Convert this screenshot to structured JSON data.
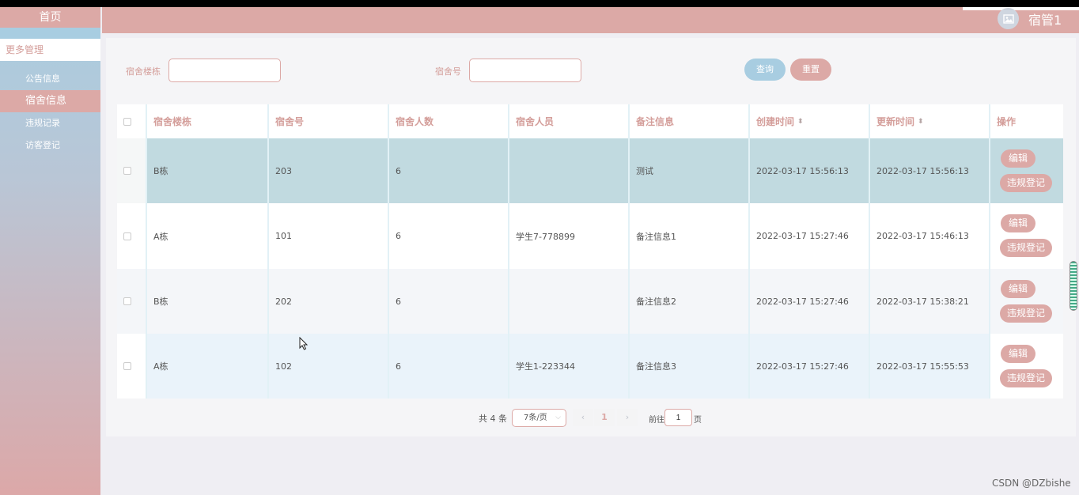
{
  "sidebar": {
    "home": "首页",
    "group": "更多管理",
    "items": [
      {
        "label": "公告信息",
        "active": false
      },
      {
        "label": "宿舍信息",
        "active": true
      },
      {
        "label": "违规记录",
        "active": false
      },
      {
        "label": "访客登记",
        "active": false
      }
    ]
  },
  "header": {
    "user_name": "宿管1"
  },
  "search": {
    "building_label": "宿舍楼栋",
    "building_value": "",
    "room_label": "宿舍号",
    "room_value": "",
    "query_button": "查询",
    "reset_button": "重置"
  },
  "table": {
    "columns": [
      "宿舍楼栋",
      "宿舍号",
      "宿舍人数",
      "宿舍人员",
      "备注信息",
      "创建时间",
      "更新时间",
      "操作"
    ],
    "rows": [
      {
        "building": "B栋",
        "room": "203",
        "count": "6",
        "members": "",
        "note": "测试",
        "created": "2022-03-17 15:56:13",
        "updated": "2022-03-17 15:56:13"
      },
      {
        "building": "A栋",
        "room": "101",
        "count": "6",
        "members": "学生7-778899",
        "note": "备注信息1",
        "created": "2022-03-17 15:27:46",
        "updated": "2022-03-17 15:46:13"
      },
      {
        "building": "B栋",
        "room": "202",
        "count": "6",
        "members": "",
        "note": "备注信息2",
        "created": "2022-03-17 15:27:46",
        "updated": "2022-03-17 15:38:21"
      },
      {
        "building": "A栋",
        "room": "102",
        "count": "6",
        "members": "学生1-223344",
        "note": "备注信息3",
        "created": "2022-03-17 15:27:46",
        "updated": "2022-03-17 15:55:53"
      }
    ],
    "edit_label": "编辑",
    "violation_label": "违规登记"
  },
  "pagination": {
    "total": "共 4 条",
    "page_size": "7条/页",
    "current_page": "1",
    "goto_label": "前往",
    "goto_value": "1",
    "page_suffix": "页"
  },
  "watermark": "CSDN @DZbishe",
  "colors": {
    "accent_pink": "#dca9a6",
    "accent_blue": "#a8cde1",
    "selected_row": "#c1dae0",
    "hover_row": "#eaf3fa"
  }
}
